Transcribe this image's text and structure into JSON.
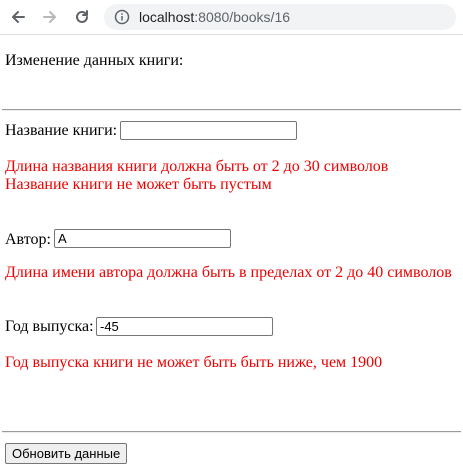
{
  "browser": {
    "url_host": "localhost",
    "url_rest": ":8080/books/16"
  },
  "form": {
    "heading": "Изменение данных книги:",
    "title": {
      "label": "Название книги:",
      "value": "",
      "errors": [
        "Длина названия книги должна быть от 2 до 30 символов",
        "Название книги не может быть пустым"
      ]
    },
    "author": {
      "label": "Автор:",
      "value": "А",
      "errors": [
        "Длина имени автора должна быть в пределах от 2 до 40 символов"
      ]
    },
    "year": {
      "label": "Год выпуска:",
      "value": "-45",
      "errors": [
        "Год выпуска книги не может быть быть ниже, чем 1900"
      ]
    },
    "submit_label": "Обновить данные"
  },
  "colors": {
    "error": "#ee0000"
  }
}
